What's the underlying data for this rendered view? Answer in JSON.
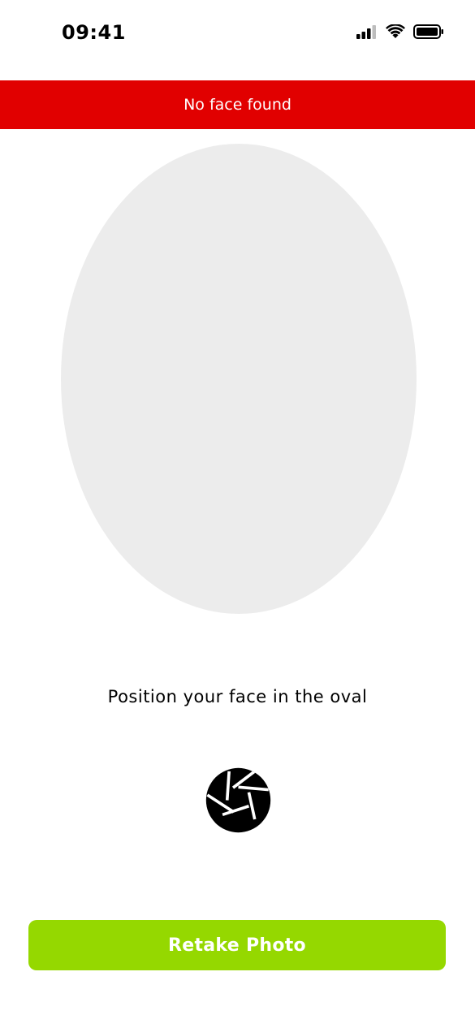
{
  "status_bar": {
    "time": "09:41",
    "icons": [
      "cellular-signal-icon",
      "wifi-icon",
      "battery-icon"
    ]
  },
  "banner": {
    "text": "No face found",
    "color": "#e10000"
  },
  "camera": {
    "oval_color": "#ececec",
    "instruction": "Position your face in the oval",
    "shutter_icon": "camera-shutter-icon"
  },
  "actions": {
    "retake_label": "Retake Photo",
    "retake_color": "#95d800"
  }
}
